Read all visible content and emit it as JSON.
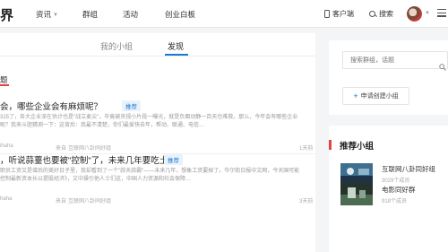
{
  "header": {
    "logo_fragment": "界",
    "nav": [
      {
        "label": "资讯",
        "has_dropdown": true
      },
      {
        "label": "群组",
        "has_dropdown": false
      },
      {
        "label": "活动",
        "has_dropdown": false
      },
      {
        "label": "创业白板",
        "has_dropdown": false
      }
    ],
    "client_label": "客户端",
    "search_label": "搜索"
  },
  "tabs": [
    {
      "label": "我的小组",
      "active": false
    },
    {
      "label": "发现",
      "active": true
    }
  ],
  "section_title_fragment": "题",
  "posts": [
    {
      "title": "会，哪些企业会有麻烦呢？",
      "badge": "推荐",
      "excerpt": "315了，各大企业深在估计也是\"战立麦尖\"，毕竟被央视小片段一曝光，就是负面动静一百天也难救，那么，今年会有哪些企业呢？我来斗胆猜测一下：这背后：我最不清楚，你们最爱快去年，帮动、联通、电信…",
      "author": "ihaha",
      "from_label": "来自",
      "group": "互联网八卦同好组",
      "time": "1天前"
    },
    {
      "title": "，听说蒜薹也要被\"控制\"了，未来几年要吃土？",
      "badge": "推荐",
      "excerpt": "职员工资又是增后的美好日子里，我却看到了一个\"蒜天蒜霸\"——未来几年，想象工资要掉了。华尔街日报中文网，今天国可能控制最新资本长以提股经济》，文中操引他人士们这，中国人力资源和社会保障…",
      "author": "haha",
      "from_label": "来自",
      "group": "互联网八卦同好组",
      "time": "3天前"
    }
  ],
  "sidebar": {
    "search_placeholder": "搜索群组，话题",
    "create_group_label": "申请创建小组",
    "recommended_title": "推荐小组",
    "groups": [
      {
        "name": "互联网八卦同好组",
        "members": "3029个成员"
      },
      {
        "name": "电影同好群",
        "members": "918个成员"
      }
    ]
  },
  "colors": {
    "accent_blue": "#1a7ad4",
    "accent_red": "#e04545"
  }
}
